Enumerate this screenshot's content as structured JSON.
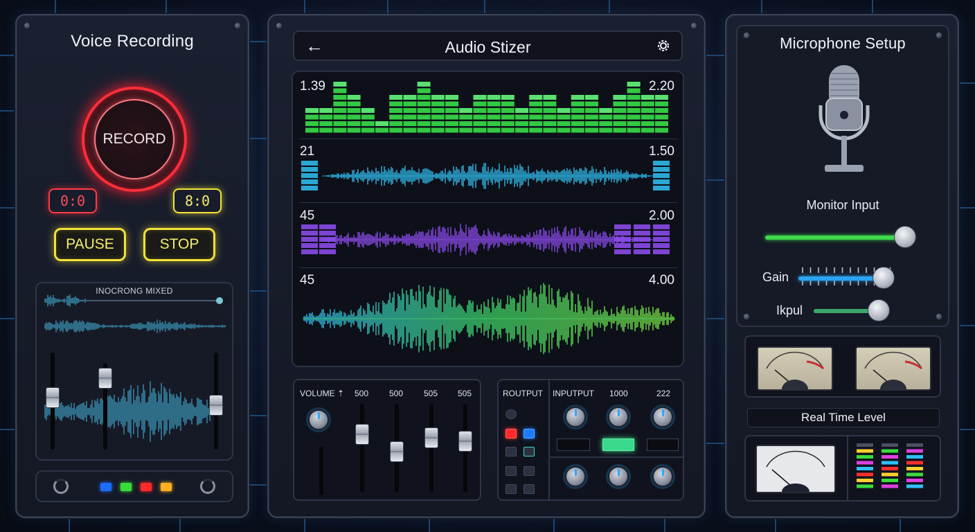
{
  "left": {
    "title": "Voice Recording",
    "record_label": "RECORD",
    "timer_red": "0:0",
    "timer_yellow": "8:0",
    "pause_label": "PAUSE",
    "stop_label": "STOP",
    "mix_label": "INOCRONG MIXED",
    "fader_levels": [
      0.55,
      0.8,
      0.45
    ],
    "status_leds": [
      "#1e6bff",
      "#3adc3a",
      "#ff2a2a",
      "#ffb020"
    ]
  },
  "center": {
    "title": "Audio Stizer",
    "tracks": [
      {
        "left": "1.39",
        "right": "2.20",
        "color": "#3ed84a"
      },
      {
        "left": "21",
        "right": "1.50",
        "color": "#2fb8e8"
      },
      {
        "left": "45",
        "right": "2.00",
        "color": "#8a4ae8"
      },
      {
        "left": "45",
        "right": "4.00",
        "color": "#4ad86a"
      }
    ],
    "eq_levels": [
      0.55,
      0.55,
      0.95,
      0.8,
      0.55,
      0.3,
      0.7,
      0.7,
      0.95,
      0.8,
      0.7,
      0.55,
      0.7,
      0.8,
      0.7,
      0.55,
      0.7,
      0.8,
      0.55,
      0.7,
      0.8,
      0.55,
      0.7,
      0.95,
      0.8,
      0.7
    ],
    "mixer": {
      "volume_label": "VOLUME ⇡",
      "channels": [
        "500",
        "500",
        "505",
        "505"
      ],
      "fader_levels": [
        0.7,
        0.45,
        0.65,
        0.6
      ]
    },
    "routing": {
      "output_label": "ROUTPUT",
      "input_label": "INPUTPUT",
      "val1": "1000",
      "val2": "222"
    }
  },
  "right": {
    "title": "Microphone Setup",
    "monitor_label": "Monitor Input",
    "monitor_level": 0.92,
    "gain_label": "Gain",
    "gain_level": 0.88,
    "input_label": "Ikpul",
    "input_level": 0.85,
    "realtime_label": "Real Time Level",
    "level_bar_colors": [
      "#ff3030",
      "#ffd030",
      "#3adc3a",
      "#e040e0",
      "#30c0ff"
    ]
  }
}
